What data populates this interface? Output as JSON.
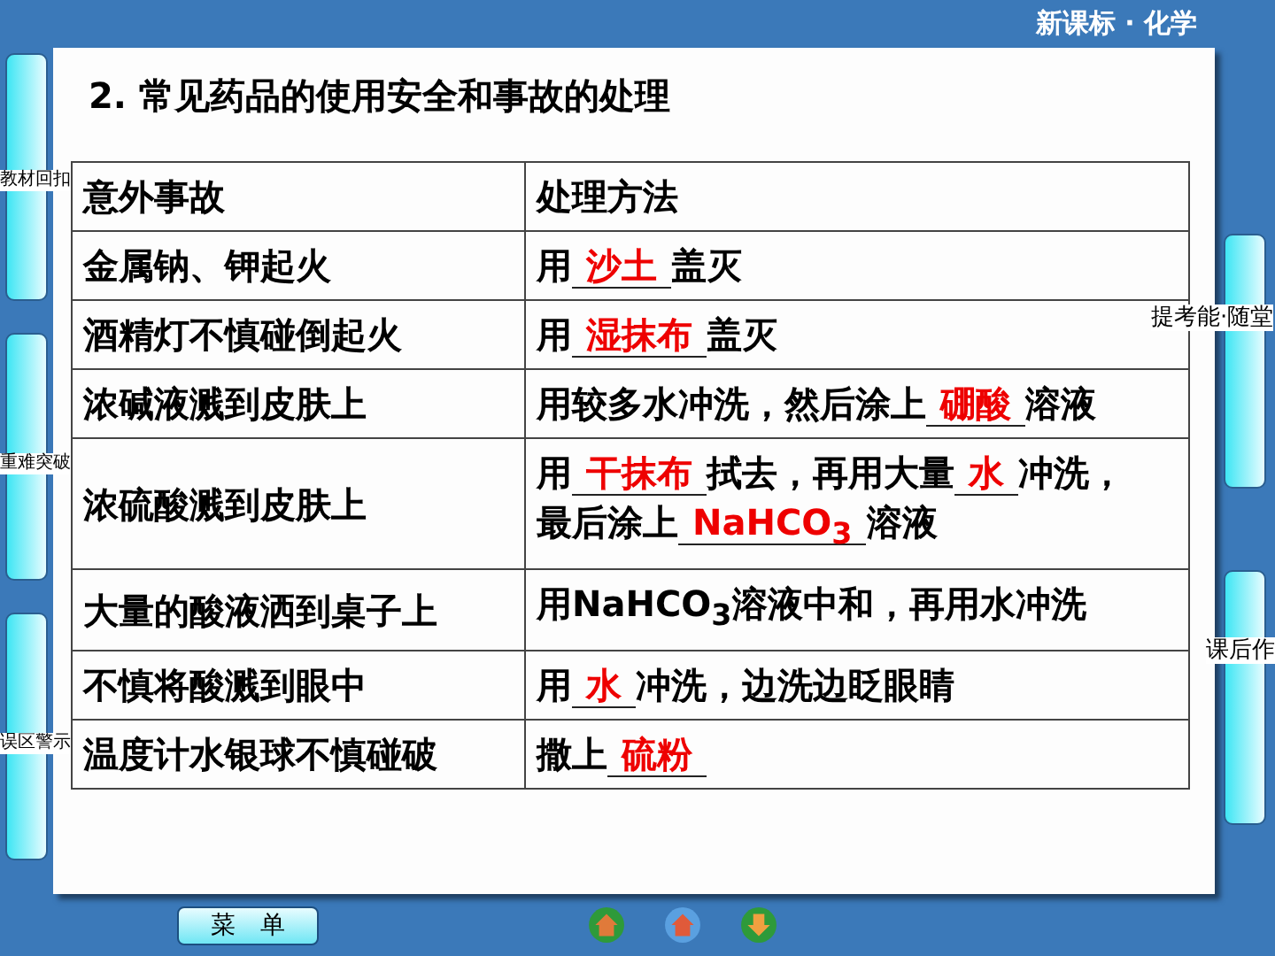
{
  "header": {
    "title": "新课标 · 化学"
  },
  "side_tabs_left": [
    {
      "label": "教材回扣"
    },
    {
      "label": "重难突破"
    },
    {
      "label": "误区警示"
    }
  ],
  "side_tabs_right": [
    {
      "label": "提考能·随堂"
    },
    {
      "label": "课后作"
    }
  ],
  "slide": {
    "heading": "2.  常见药品的使用安全和事故的处理",
    "table": {
      "columns": [
        "意外事故",
        "处理方法"
      ],
      "rows": [
        {
          "accident": "金属钠、钾起火",
          "treatment": [
            {
              "kind": "text",
              "text": "用"
            },
            {
              "kind": "blank",
              "text": "沙土"
            },
            {
              "kind": "text",
              "text": "盖灭"
            }
          ]
        },
        {
          "accident": "酒精灯不慎碰倒起火",
          "treatment": [
            {
              "kind": "text",
              "text": "用"
            },
            {
              "kind": "blank",
              "text": "湿抹布"
            },
            {
              "kind": "text",
              "text": "盖灭"
            }
          ]
        },
        {
          "accident": "浓碱液溅到皮肤上",
          "treatment": [
            {
              "kind": "text",
              "text": "用较多水冲洗，然后涂上"
            },
            {
              "kind": "blank",
              "text": "硼酸"
            },
            {
              "kind": "text",
              "text": "溶液"
            }
          ]
        },
        {
          "accident": "浓硫酸溅到皮肤上",
          "treatment": [
            {
              "kind": "text",
              "text": "用"
            },
            {
              "kind": "blank",
              "text": "干抹布"
            },
            {
              "kind": "text",
              "text": "拭去，再用大量"
            },
            {
              "kind": "blank",
              "text": "水"
            },
            {
              "kind": "text",
              "text": "冲洗，"
            },
            {
              "kind": "break"
            },
            {
              "kind": "text",
              "text": "最后涂上"
            },
            {
              "kind": "blank",
              "text": "NaHCO$_{3}$"
            },
            {
              "kind": "text",
              "text": "溶液"
            }
          ]
        },
        {
          "accident": "大量的酸液洒到桌子上",
          "treatment": [
            {
              "kind": "text",
              "text": "用NaHCO$_{3}$溶液中和，再用水冲洗"
            }
          ]
        },
        {
          "accident": "不慎将酸溅到眼中",
          "treatment": [
            {
              "kind": "text",
              "text": "用"
            },
            {
              "kind": "blank",
              "text": "水"
            },
            {
              "kind": "text",
              "text": "冲洗，边洗边眨眼睛"
            }
          ]
        },
        {
          "accident": "温度计水银球不慎碰破",
          "treatment": [
            {
              "kind": "text",
              "text": "撒上"
            },
            {
              "kind": "blank",
              "text": "硫粉"
            }
          ]
        }
      ]
    }
  },
  "footer": {
    "menu_button": "菜　单"
  }
}
